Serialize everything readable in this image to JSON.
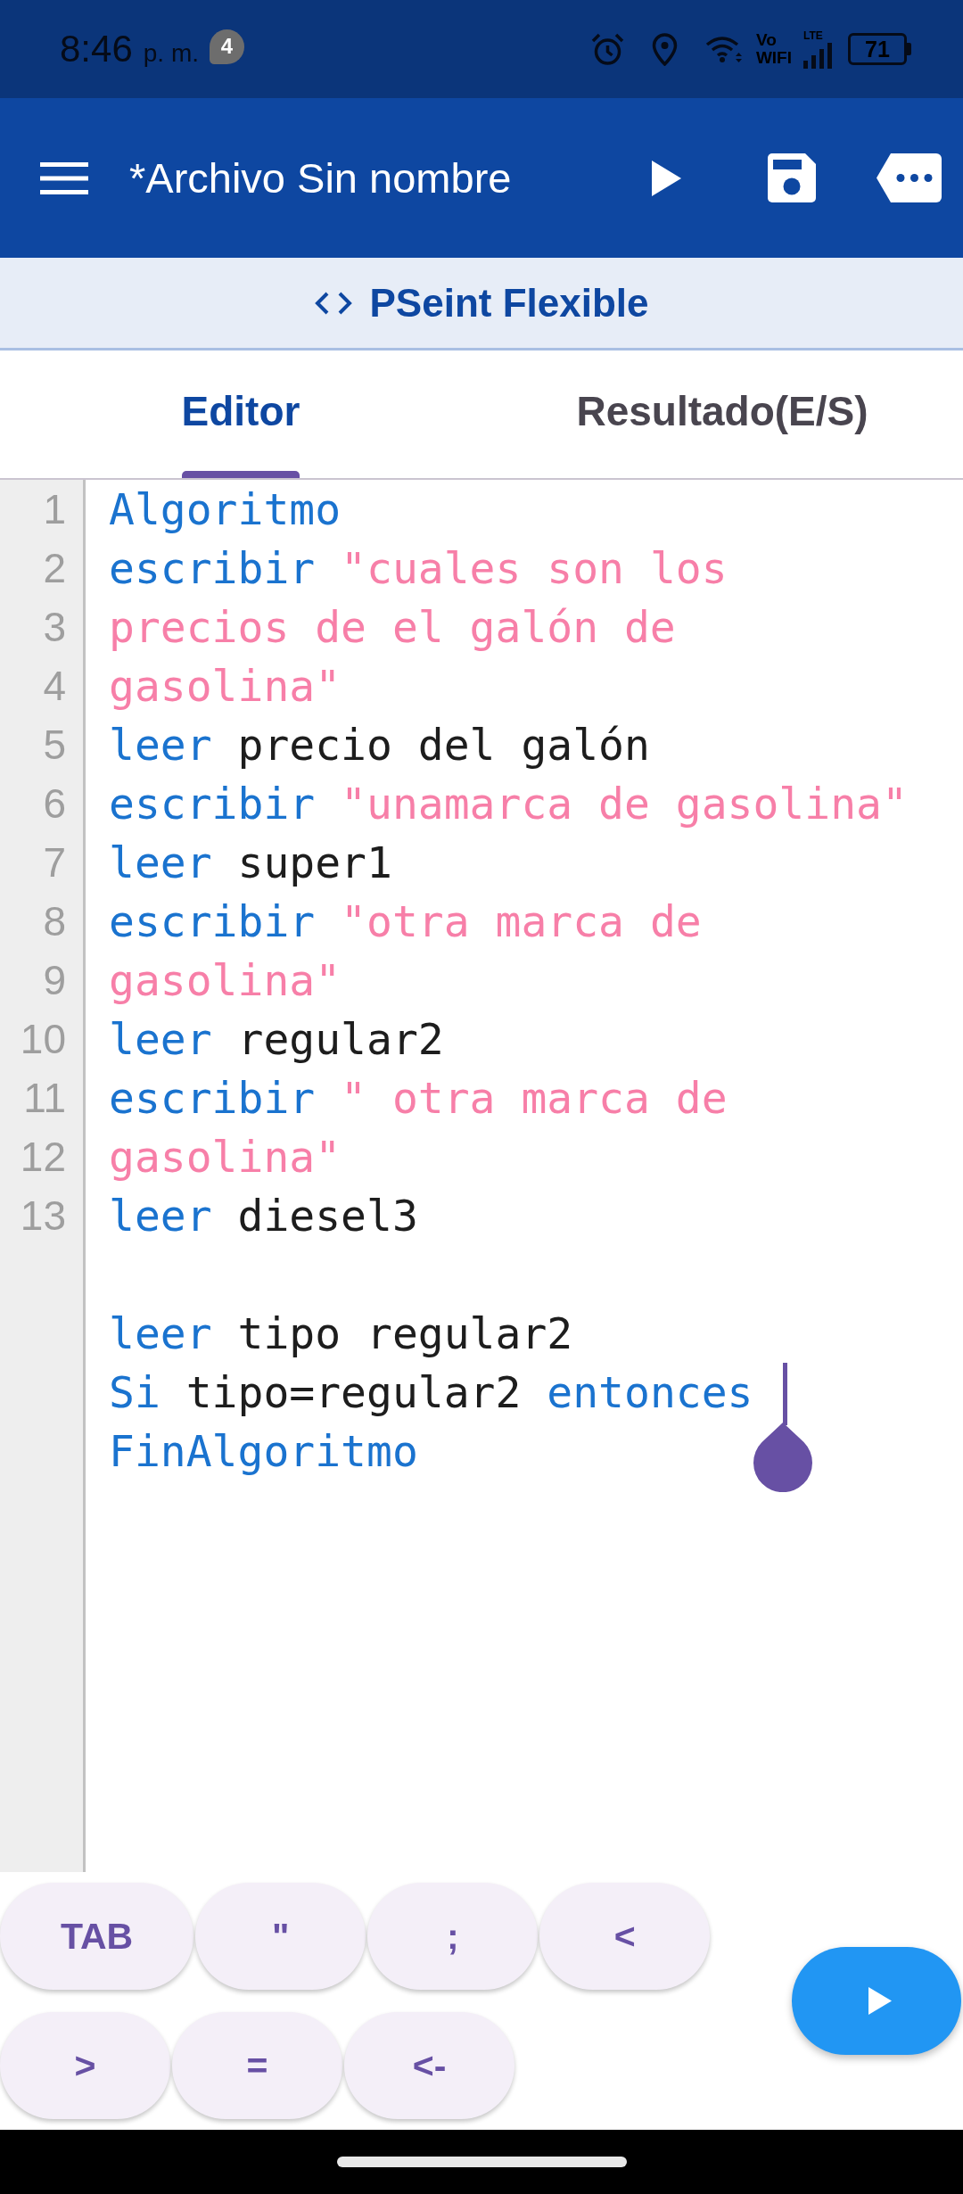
{
  "status_bar": {
    "time": "8:46",
    "meridiem": "p. m.",
    "notification_count": "4",
    "wifi_calling": [
      "Vo",
      "WIFI"
    ],
    "network_type": "LTE",
    "battery": "71"
  },
  "app_bar": {
    "title": "*Archivo Sin nombre"
  },
  "subheader": {
    "title": "PSeint Flexible"
  },
  "tabs": [
    {
      "label": "Editor",
      "selected": true
    },
    {
      "label": "Resultado(E/S)",
      "selected": false
    }
  ],
  "editor": {
    "line_numbers": [
      "1",
      "2",
      "3",
      "4",
      "5",
      "6",
      "7",
      "8",
      "9",
      "10",
      "11",
      "12",
      "13"
    ],
    "lines": [
      {
        "kind": "code",
        "cursor": false,
        "tokens": [
          {
            "kind": "keyword",
            "text": "Algoritmo"
          }
        ]
      },
      {
        "kind": "code",
        "cursor": false,
        "tokens": [
          {
            "kind": "keyword",
            "text": "escribir"
          },
          {
            "kind": "string",
            "text": "\"cuales son los"
          }
        ]
      },
      {
        "kind": "code",
        "cursor": false,
        "tokens": [
          {
            "kind": "string",
            "text": "precios de el galón de"
          }
        ]
      },
      {
        "kind": "code",
        "cursor": false,
        "tokens": [
          {
            "kind": "string",
            "text": "gasolina\""
          }
        ]
      },
      {
        "kind": "code",
        "cursor": false,
        "tokens": [
          {
            "kind": "keyword",
            "text": "leer"
          },
          {
            "kind": "identifier",
            "text": "precio del galón"
          }
        ]
      },
      {
        "kind": "code",
        "cursor": false,
        "tokens": [
          {
            "kind": "keyword",
            "text": "escribir"
          },
          {
            "kind": "string",
            "text": "\"unamarca de gasolina\""
          }
        ]
      },
      {
        "kind": "code",
        "cursor": false,
        "tokens": [
          {
            "kind": "keyword",
            "text": "leer"
          },
          {
            "kind": "identifier",
            "text": "super1"
          }
        ]
      },
      {
        "kind": "code",
        "cursor": false,
        "tokens": [
          {
            "kind": "keyword",
            "text": "escribir"
          },
          {
            "kind": "string",
            "text": "\"otra marca de"
          }
        ]
      },
      {
        "kind": "code",
        "cursor": false,
        "tokens": [
          {
            "kind": "string",
            "text": "gasolina\""
          }
        ]
      },
      {
        "kind": "code",
        "cursor": false,
        "tokens": [
          {
            "kind": "keyword",
            "text": "leer"
          },
          {
            "kind": "identifier",
            "text": "regular2"
          }
        ]
      },
      {
        "kind": "code",
        "cursor": false,
        "tokens": [
          {
            "kind": "keyword",
            "text": "escribir"
          },
          {
            "kind": "string",
            "text": "\" otra marca de"
          }
        ]
      },
      {
        "kind": "code",
        "cursor": false,
        "tokens": [
          {
            "kind": "string",
            "text": "gasolina\""
          }
        ]
      },
      {
        "kind": "code",
        "cursor": false,
        "tokens": [
          {
            "kind": "keyword",
            "text": "leer"
          },
          {
            "kind": "identifier",
            "text": "diesel3"
          }
        ]
      },
      {
        "kind": "blank",
        "cursor": false
      },
      {
        "kind": "code",
        "cursor": false,
        "tokens": [
          {
            "kind": "keyword",
            "text": "leer"
          },
          {
            "kind": "identifier",
            "text": "tipo regular2"
          }
        ]
      },
      {
        "kind": "code",
        "cursor": true,
        "tokens": [
          {
            "kind": "keyword",
            "text": "Si"
          },
          {
            "kind": "identifier",
            "text": "tipo=regular2"
          },
          {
            "kind": "keyword",
            "text": "entonces"
          }
        ]
      },
      {
        "kind": "code",
        "cursor": false,
        "tokens": [
          {
            "kind": "keyword",
            "text": "FinAlgoritmo"
          }
        ]
      }
    ]
  },
  "key_rows": [
    [
      "TAB",
      "\"",
      ";",
      "<"
    ],
    [
      ">",
      "=",
      "<-"
    ]
  ]
}
